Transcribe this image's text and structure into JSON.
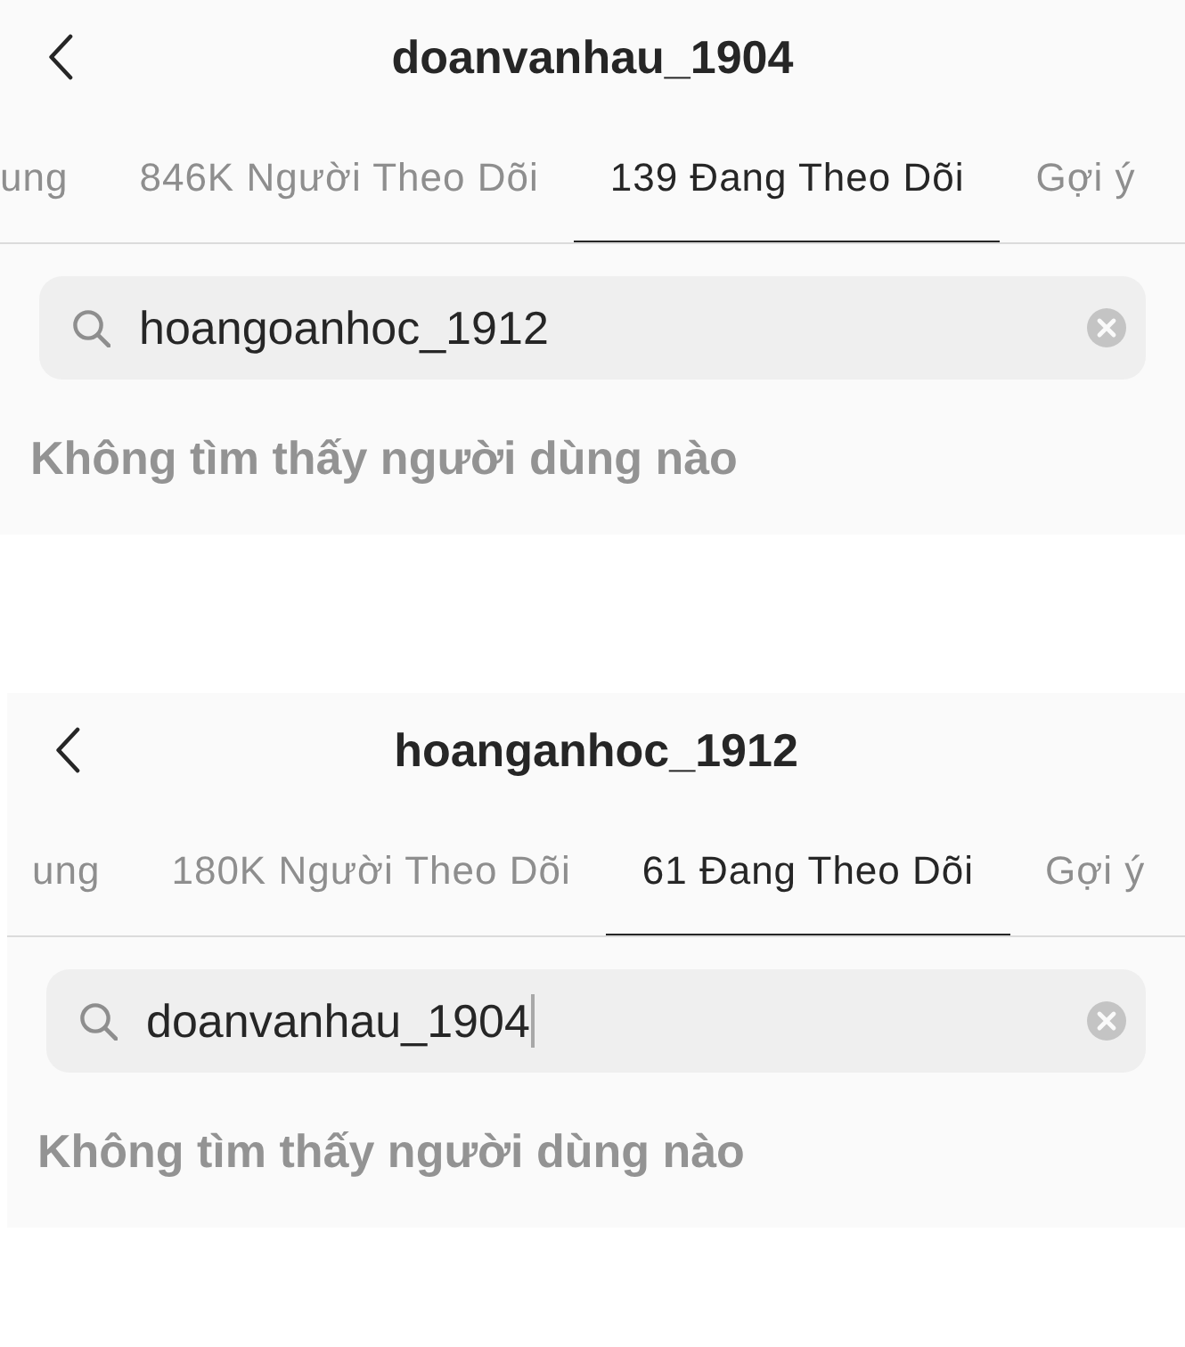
{
  "screens": [
    {
      "title": "doanvanhau_1904",
      "tabs": [
        {
          "label": "ung",
          "selected": false
        },
        {
          "label": "846K Người Theo Dõi",
          "selected": false
        },
        {
          "label": "139 Đang Theo Dõi",
          "selected": true
        },
        {
          "label": "Gợi ý",
          "selected": false
        }
      ],
      "search": {
        "value": "hoangoanhoc_1912",
        "focused": false
      },
      "empty_message": "Không tìm thấy người dùng nào"
    },
    {
      "title": "hoanganhoc_1912",
      "tabs": [
        {
          "label": "ung",
          "selected": false
        },
        {
          "label": "180K Người Theo Dõi",
          "selected": false
        },
        {
          "label": "61 Đang Theo Dõi",
          "selected": true
        },
        {
          "label": "Gợi ý",
          "selected": false
        }
      ],
      "search": {
        "value": "doanvanhau_1904",
        "focused": true
      },
      "empty_message": "Không tìm thấy người dùng nào"
    }
  ]
}
